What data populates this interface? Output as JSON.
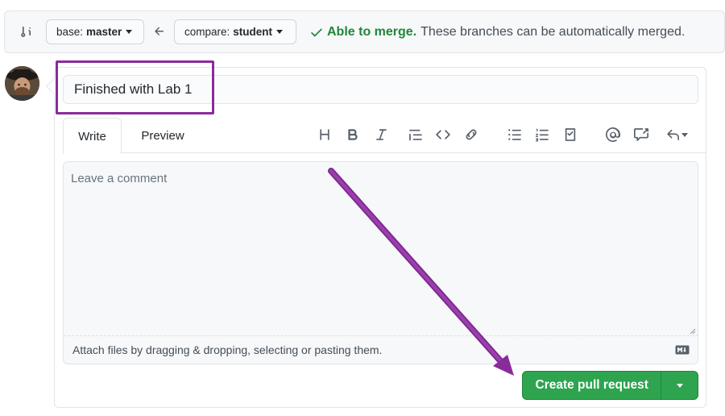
{
  "compare_bar": {
    "base_label": "base:",
    "base_branch": "master",
    "compare_label": "compare:",
    "compare_branch": "student",
    "merge_status": "Able to merge.",
    "merge_description": "These branches can be automatically merged."
  },
  "pull_request": {
    "title_value": "Finished with Lab 1",
    "tabs": [
      {
        "label": "Write",
        "active": true
      },
      {
        "label": "Preview",
        "active": false
      }
    ],
    "toolbar_icons": [
      "heading-icon",
      "bold-icon",
      "italic-icon",
      "quote-icon",
      "code-icon",
      "link-icon",
      "bullet-list-icon",
      "numbered-list-icon",
      "task-list-icon",
      "mention-icon",
      "reference-icon",
      "reply-icon"
    ],
    "comment_placeholder": "Leave a comment",
    "attach_text": "Attach files by dragging & dropping, selecting or pasting them.",
    "create_button_label": "Create pull request"
  },
  "colors": {
    "accent_green": "#2ea44f",
    "merge_green": "#22863a",
    "annotation_purple": "#8a2b9b"
  }
}
